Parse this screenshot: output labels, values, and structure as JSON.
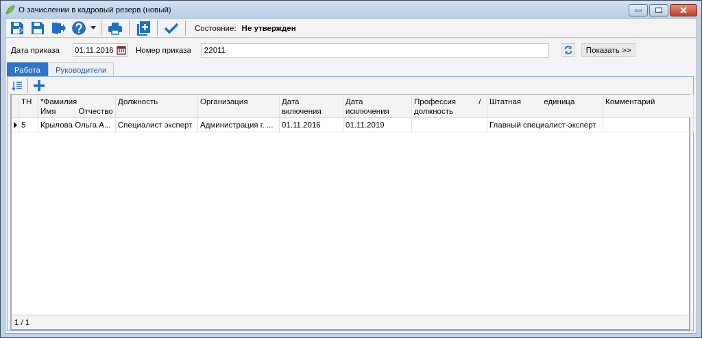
{
  "window": {
    "title": "О зачислении в кадровый резерв (новый)"
  },
  "toolbar": {
    "status_label": "Состояние:",
    "status_value": "Не утвержден"
  },
  "form": {
    "date_label": "Дата приказа",
    "date_value": "01.11.2016",
    "number_label": "Номер приказа",
    "number_value": "22011",
    "show_button": "Показать >>"
  },
  "tabs": [
    {
      "label": "Работа",
      "selected": true
    },
    {
      "label": "Руководители",
      "selected": false
    }
  ],
  "table": {
    "columns": [
      "ТН",
      "*Фамилия Имя Отчество",
      "Должность",
      "Организация",
      "Дата включения",
      "Дата исключения",
      "Профессия / должность",
      "Штатная единица",
      "Комментарий"
    ],
    "rows": [
      {
        "selected": true,
        "cells": [
          "5",
          "Крылова Ольга А...",
          "Специалист эксперт",
          "Администрация г. ...",
          "01.11.2016",
          "01.11.2019",
          "",
          "Главный специалист-эксперт",
          ""
        ]
      }
    ]
  },
  "status_bar": {
    "pager": "1 / 1"
  }
}
